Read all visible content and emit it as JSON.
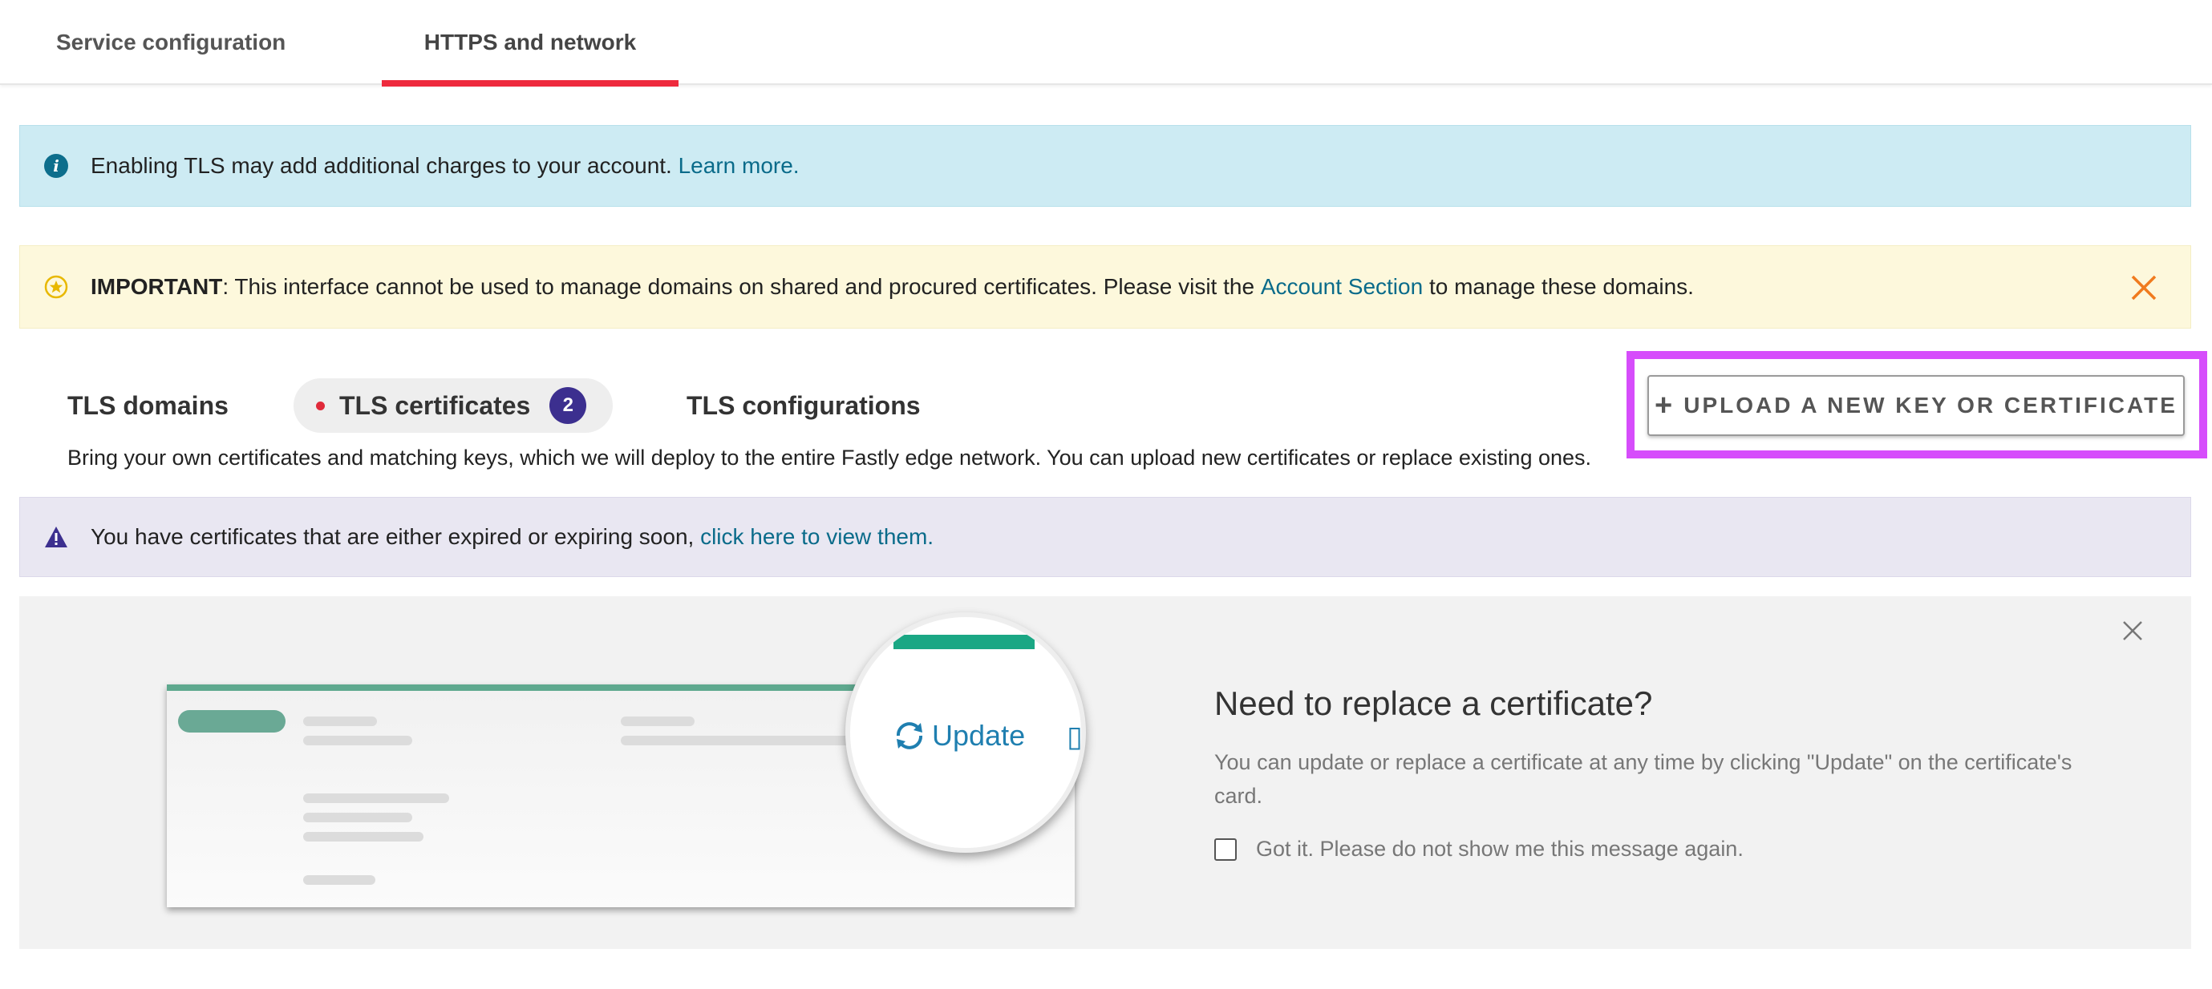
{
  "nav": {
    "tabs": [
      {
        "label": "Service configuration"
      },
      {
        "label": "HTTPS and network"
      }
    ]
  },
  "info_alert": {
    "text": "Enabling TLS may add additional charges to your account.",
    "link": "Learn more."
  },
  "important_alert": {
    "bold": "IMPORTANT",
    "text_before": ": This interface cannot be used to manage domains on shared and procured certificates. Please visit the",
    "link": "Account Section",
    "text_after": "to manage these domains."
  },
  "subtabs": [
    {
      "label": "TLS domains"
    },
    {
      "label": "TLS certificates",
      "badge": "2"
    },
    {
      "label": "TLS configurations"
    }
  ],
  "description": "Bring your own certificates and matching keys, which we will deploy to the entire Fastly edge network. You can upload new certificates or replace existing ones.",
  "upload_button": {
    "label": "UPLOAD A NEW KEY OR CERTIFICATE"
  },
  "expiry_alert": {
    "text": "You have certificates that are either expired or expiring soon,",
    "link": "click here to view them."
  },
  "promo": {
    "title": "Need to replace a certificate?",
    "text": "You can update or replace a certificate at any time by clicking \"Update\" on the certificate's card.",
    "checkbox_label": "Got it. Please do not show me this message again.",
    "illustration_update": "Update"
  },
  "colors": {
    "accent_red": "#ee2a3d",
    "highlight": "#d64dfb",
    "badge": "#3c2f8f",
    "link": "#0a6b8a"
  }
}
